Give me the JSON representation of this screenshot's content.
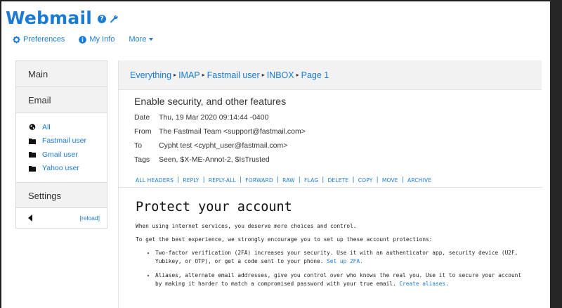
{
  "app": {
    "title": "Webmail",
    "help_glyph": "?",
    "accent_color": "#1a7bd4"
  },
  "topnav": {
    "preferences": "Preferences",
    "my_info": "My Info",
    "more": "More"
  },
  "sidebar": {
    "main": "Main",
    "email": "Email",
    "items": [
      {
        "label": "All",
        "icon": "globe-icon"
      },
      {
        "label": "Fastmail user",
        "icon": "folder-icon"
      },
      {
        "label": "Gmail user",
        "icon": "folder-icon"
      },
      {
        "label": "Yahoo user",
        "icon": "folder-icon"
      }
    ],
    "settings": "Settings",
    "reload": "[reload]"
  },
  "breadcrumb": [
    "Everything",
    "IMAP",
    "Fastmail user",
    "INBOX",
    "Page 1"
  ],
  "message": {
    "subject": "Enable security, and other features",
    "headers": [
      {
        "label": "Date",
        "value": "Thu, 19 Mar 2020 09:14:44 -0400"
      },
      {
        "label": "From",
        "value": "The Fastmail Team <support@fastmail.com>"
      },
      {
        "label": "To",
        "value": "Cypht test <cypht_user@fastmail.com>"
      },
      {
        "label": "Tags",
        "value": "Seen, $X-ME-Annot-2, $IsTrusted"
      }
    ],
    "actions": [
      "ALL HEADERS",
      "REPLY",
      "REPLY-ALL",
      "FORWARD",
      "RAW",
      "FLAG",
      "DELETE",
      "COPY",
      "MOVE",
      "ARCHIVE"
    ]
  },
  "body": {
    "heading": "Protect your account",
    "p1": "When using internet services, you deserve more choices and control.",
    "p2": "To get the best experience, we strongly encourage you to set up these account protections:",
    "bullet1_text": "Two-factor verification (2FA) increases your security. Use it with an authenticator app, security device (U2F, Yubikey, or OTP), or get a code sent to your phone. ",
    "bullet1_link": "Set up 2FA.",
    "bullet2_text": "Aliases, alternate email addresses, give you control over who knows the real you. Use it to secure your account by making it harder to match a compromised password with your true email. ",
    "bullet2_link": "Create aliases."
  }
}
